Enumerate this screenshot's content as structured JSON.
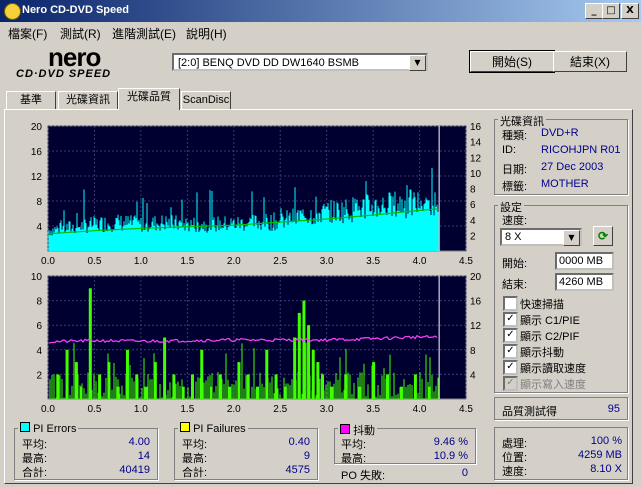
{
  "window": {
    "title": "Nero CD-DVD Speed",
    "btn_min": "_",
    "btn_max": "□",
    "btn_close": "X"
  },
  "menu": [
    "檔案(F)",
    "測試(R)",
    "進階測試(E)",
    "說明(H)"
  ],
  "logo": {
    "nero": "nero",
    "sub": "CD·DVD SPEED"
  },
  "drive": {
    "selected": "[2:0]  BENQ DVD DD DW1640 BSMB"
  },
  "buttons": {
    "start": "開始(S)",
    "exit": "結束(X)"
  },
  "tabs": [
    "基準",
    "光碟資訊",
    "光碟品質",
    "ScanDisc"
  ],
  "disc_info": {
    "title": "光碟資訊",
    "type_label": "種類:",
    "type": "DVD+R",
    "id_label": "ID:",
    "id": "RICOHJPN R01",
    "date_label": "日期:",
    "date": "27 Dec 2003",
    "tag_label": "標籤:",
    "tag": "MOTHER"
  },
  "settings": {
    "title": "設定",
    "speed_label": "速度:",
    "speed": "8 X",
    "start_label": "開始:",
    "start": "0000 MB",
    "end_label": "結束:",
    "end": "4260 MB",
    "checks": [
      {
        "label": "快速掃描",
        "checked": false,
        "disabled": false
      },
      {
        "label": "顯示 C1/PIE",
        "checked": true,
        "disabled": false
      },
      {
        "label": "顯示 C2/PIF",
        "checked": true,
        "disabled": false
      },
      {
        "label": "顯示抖動",
        "checked": true,
        "disabled": false
      },
      {
        "label": "顯示讀取速度",
        "checked": true,
        "disabled": false
      },
      {
        "label": "顯示寫入速度",
        "checked": true,
        "disabled": true
      }
    ]
  },
  "quality": {
    "label": "品質測試得",
    "score": "95"
  },
  "progress": {
    "proc_label": "處理:",
    "proc": "100 %",
    "pos_label": "位置:",
    "pos": "4259 MB",
    "speed_label": "速度:",
    "speed": "8.10 X"
  },
  "stats": {
    "pi_errors": {
      "title": "PI Errors",
      "color": "#00ffff",
      "avg_label": "平均:",
      "avg": "4.00",
      "max_label": "最高:",
      "max": "14",
      "total_label": "合計:",
      "total": "40419"
    },
    "pi_failures": {
      "title": "PI Failures",
      "color": "#ffff00",
      "avg_label": "平均:",
      "avg": "0.40",
      "max_label": "最高:",
      "max": "9",
      "total_label": "合計:",
      "total": "4575"
    },
    "jitter": {
      "title": "抖動",
      "color": "#ff00ff",
      "avg_label": "平均:",
      "avg": "9.46 %",
      "max_label": "最高:",
      "max": "10.9 %"
    },
    "po_label": "PO 失敗:",
    "po": "0"
  },
  "chart_data": [
    {
      "type": "area",
      "x_ticks": [
        "0.0",
        "0.5",
        "1.0",
        "1.5",
        "2.0",
        "2.5",
        "3.0",
        "3.5",
        "4.0",
        "4.5"
      ],
      "xlim": [
        0,
        4.5
      ],
      "y_left_ticks": [
        "20",
        "16",
        "12",
        "8",
        "4"
      ],
      "ylim_left": [
        0,
        20
      ],
      "y_right_ticks": [
        "16",
        "14",
        "12",
        "10",
        "8",
        "6",
        "4",
        "2"
      ],
      "ylim_right": [
        0,
        16
      ],
      "series": [
        {
          "values_x": [
            0,
            0.25,
            0.5,
            0.75,
            1.0,
            1.25,
            1.5,
            1.75,
            2.0,
            2.25,
            2.5,
            2.75,
            3.0,
            3.25,
            3.5,
            3.75,
            4.0,
            4.2
          ],
          "values_y": [
            3.5,
            4,
            4.5,
            4.8,
            4.5,
            4.8,
            4.5,
            4.5,
            4.6,
            4.8,
            5,
            6,
            6.5,
            7,
            7.5,
            7.8,
            8,
            8
          ]
        },
        {
          "values_x": [
            0,
            0.5,
            1.0,
            1.5,
            2.0,
            2.5,
            3.0,
            3.5,
            4.0,
            4.2
          ],
          "values_y": [
            2.2,
            2.6,
            2.9,
            3.1,
            3.3,
            3.7,
            4.1,
            4.6,
            5.2,
            5.4
          ]
        }
      ],
      "grid": true
    },
    {
      "type": "bar",
      "x_ticks": [
        "0.0",
        "0.5",
        "1.0",
        "1.5",
        "2.0",
        "2.5",
        "3.0",
        "3.5",
        "4.0",
        "4.5"
      ],
      "xlim": [
        0,
        4.5
      ],
      "y_left_ticks": [
        "10",
        "8",
        "6",
        "4",
        "2"
      ],
      "ylim_left": [
        0,
        10
      ],
      "y_right_ticks": [
        "20",
        "16",
        "12",
        "8",
        "4"
      ],
      "ylim_right": [
        0,
        20
      ],
      "series": [
        {
          "values_x": [
            0.1,
            0.2,
            0.3,
            0.35,
            0.45,
            0.55,
            0.65,
            0.75,
            0.85,
            0.95,
            1.05,
            1.15,
            1.25,
            1.35,
            1.45,
            1.55,
            1.65,
            1.75,
            1.85,
            1.95,
            2.05,
            2.15,
            2.25,
            2.35,
            2.45,
            2.55,
            2.65,
            2.7,
            2.75,
            2.8,
            2.85,
            2.9,
            2.95,
            3.05,
            3.2,
            3.35,
            3.5,
            3.65,
            3.8,
            3.95,
            4.1
          ],
          "values_y": [
            2,
            4,
            3,
            1,
            9,
            2,
            3,
            1,
            4,
            2,
            1,
            3,
            5,
            2,
            1,
            2,
            4,
            1,
            2,
            1,
            3,
            2,
            1,
            4,
            2,
            1,
            5,
            7,
            8,
            6,
            4,
            3,
            2,
            1,
            2,
            1,
            3,
            2,
            1,
            2,
            1
          ]
        },
        {
          "values_x": [
            0,
            0.5,
            1.0,
            1.5,
            2.0,
            2.5,
            3.0,
            3.5,
            4.0,
            4.2
          ],
          "values_y": [
            9.3,
            9.5,
            9.4,
            9.5,
            9.6,
            9.6,
            9.6,
            9.8,
            10.1,
            10
          ]
        }
      ],
      "grid": true
    }
  ]
}
